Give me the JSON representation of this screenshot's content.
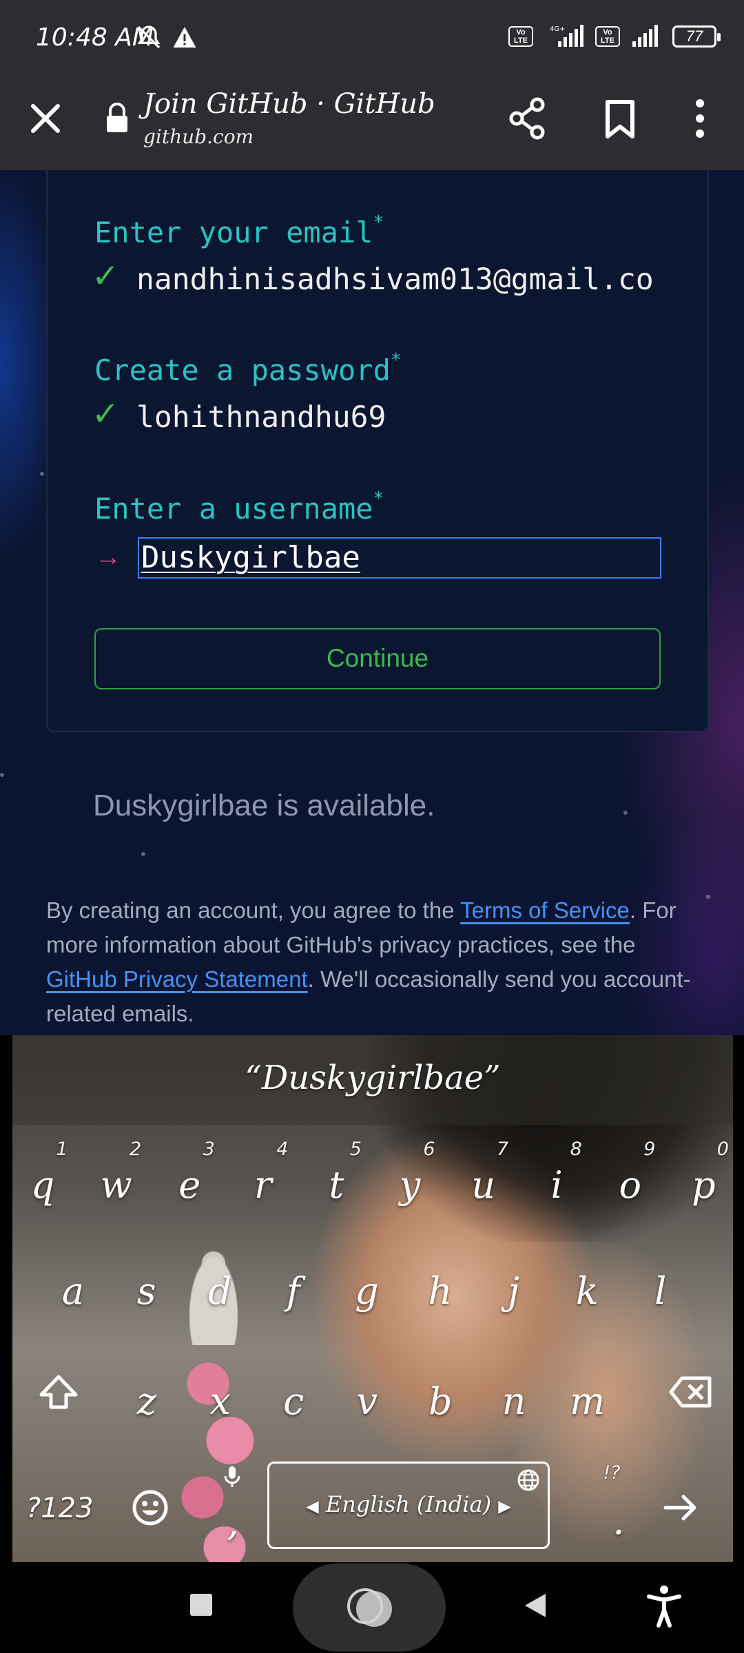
{
  "status_bar": {
    "time": "10:48 AM",
    "volte_label": "Vo LTE",
    "network_label": "4G+",
    "battery_level": "77"
  },
  "browser": {
    "title": "Join GitHub · GitHub",
    "url": "github.com"
  },
  "form": {
    "email_label": "Enter your email",
    "email_value": "nandhinisadhsivam013@gmail.co",
    "password_label": "Create a password",
    "password_value": "lohithnandhu69",
    "username_label": "Enter a username",
    "username_value": "Duskygirlbae",
    "required_mark": "*",
    "check_mark": "✓",
    "arrow_mark": "→",
    "continue_label": "Continue"
  },
  "availability_message": "Duskygirlbae is available.",
  "terms": {
    "text_1": "By creating an account, you agree to the ",
    "tos_link": "Terms of Service",
    "text_2": ". For more information about GitHub's privacy practices, see the ",
    "privacy_link": "GitHub Privacy Statement",
    "text_3": ". We'll occasionally send you account-related emails."
  },
  "keyboard": {
    "suggestion": "“Duskygirlbae”",
    "row1": [
      "q",
      "w",
      "e",
      "r",
      "t",
      "y",
      "u",
      "i",
      "o",
      "p"
    ],
    "row1_hints": [
      "1",
      "2",
      "3",
      "4",
      "5",
      "6",
      "7",
      "8",
      "9",
      "0"
    ],
    "row2": [
      "a",
      "s",
      "d",
      "f",
      "g",
      "h",
      "j",
      "k",
      "l"
    ],
    "row3": [
      "z",
      "x",
      "c",
      "v",
      "b",
      "n",
      "m"
    ],
    "symbols_key": "?123",
    "comma_key": ",",
    "period_key": ".",
    "punct_hint": "!?",
    "spacebar_label": "English (India)"
  },
  "colors": {
    "label_teal": "#2ac3c3",
    "check_green": "#3fb950",
    "arrow_pink": "#d6457a",
    "link_blue": "#4493f8",
    "input_border": "#3b82f6"
  }
}
